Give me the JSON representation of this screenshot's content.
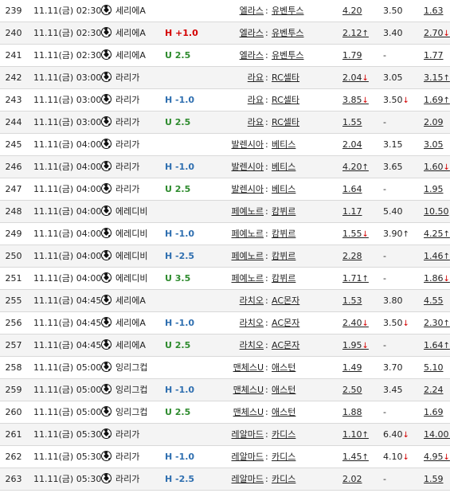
{
  "rows": [
    {
      "no": "239",
      "time": "11.11(금) 02:30",
      "league": "세리에A",
      "handicap": "",
      "home": "엘라스",
      "away": "유벤투스",
      "odds": [
        "4.20",
        "3.50",
        "1.63"
      ],
      "arrows": [
        "",
        "",
        ""
      ]
    },
    {
      "no": "240",
      "time": "11.11(금) 02:30",
      "league": "세리에A",
      "handicap": "H +1.0",
      "home": "엘라스",
      "away": "유벤투스",
      "odds": [
        "2.12",
        "3.40",
        "2.70"
      ],
      "arrows": [
        "↑",
        "",
        "↓"
      ]
    },
    {
      "no": "241",
      "time": "11.11(금) 02:30",
      "league": "세리에A",
      "handicap": "U 2.5",
      "home": "엘라스",
      "away": "유벤투스",
      "odds": [
        "1.79",
        "-",
        "1.77"
      ],
      "arrows": [
        "",
        "",
        ""
      ]
    },
    {
      "no": "242",
      "time": "11.11(금) 03:00",
      "league": "라리가",
      "handicap": "",
      "home": "라요",
      "away": "RC셀타",
      "odds": [
        "2.04",
        "3.05",
        "3.15"
      ],
      "arrows": [
        "↓",
        "",
        "↑"
      ]
    },
    {
      "no": "243",
      "time": "11.11(금) 03:00",
      "league": "라리가",
      "handicap": "H -1.0",
      "home": "라요",
      "away": "RC셀타",
      "odds": [
        "3.85",
        "3.50",
        "1.69"
      ],
      "arrows": [
        "↓",
        "↓",
        "↑"
      ]
    },
    {
      "no": "244",
      "time": "11.11(금) 03:00",
      "league": "라리가",
      "handicap": "U 2.5",
      "home": "라요",
      "away": "RC셀타",
      "odds": [
        "1.55",
        "-",
        "2.09"
      ],
      "arrows": [
        "",
        "",
        ""
      ]
    },
    {
      "no": "245",
      "time": "11.11(금) 04:00",
      "league": "라리가",
      "handicap": "",
      "home": "발렌시아",
      "away": "베티스",
      "odds": [
        "2.04",
        "3.15",
        "3.05"
      ],
      "arrows": [
        "",
        "",
        ""
      ]
    },
    {
      "no": "246",
      "time": "11.11(금) 04:00",
      "league": "라리가",
      "handicap": "H -1.0",
      "home": "발렌시아",
      "away": "베티스",
      "odds": [
        "4.20",
        "3.65",
        "1.60"
      ],
      "arrows": [
        "↑",
        "",
        "↓"
      ]
    },
    {
      "no": "247",
      "time": "11.11(금) 04:00",
      "league": "라리가",
      "handicap": "U 2.5",
      "home": "발렌시아",
      "away": "베티스",
      "odds": [
        "1.64",
        "-",
        "1.95"
      ],
      "arrows": [
        "",
        "",
        ""
      ]
    },
    {
      "no": "248",
      "time": "11.11(금) 04:00",
      "league": "에레디비",
      "handicap": "",
      "home": "페예노르",
      "away": "캄뷔르",
      "odds": [
        "1.17",
        "5.40",
        "10.50"
      ],
      "arrows": [
        "",
        "",
        ""
      ]
    },
    {
      "no": "249",
      "time": "11.11(금) 04:00",
      "league": "에레디비",
      "handicap": "H -1.0",
      "home": "페예노르",
      "away": "캄뷔르",
      "odds": [
        "1.55",
        "3.90",
        "4.25"
      ],
      "arrows": [
        "↓",
        "↑",
        "↑"
      ]
    },
    {
      "no": "250",
      "time": "11.11(금) 04:00",
      "league": "에레디비",
      "handicap": "H -2.5",
      "home": "페예노르",
      "away": "캄뷔르",
      "odds": [
        "2.28",
        "-",
        "1.46"
      ],
      "arrows": [
        "",
        "",
        "↑"
      ]
    },
    {
      "no": "251",
      "time": "11.11(금) 04:00",
      "league": "에레디비",
      "handicap": "U 3.5",
      "home": "페예노르",
      "away": "캄뷔르",
      "odds": [
        "1.71",
        "-",
        "1.86"
      ],
      "arrows": [
        "↑",
        "",
        "↓"
      ]
    },
    {
      "no": "255",
      "time": "11.11(금) 04:45",
      "league": "세리에A",
      "handicap": "",
      "home": "라치오",
      "away": "AC몬자",
      "odds": [
        "1.53",
        "3.80",
        "4.55"
      ],
      "arrows": [
        "",
        "",
        ""
      ]
    },
    {
      "no": "256",
      "time": "11.11(금) 04:45",
      "league": "세리에A",
      "handicap": "H -1.0",
      "home": "라치오",
      "away": "AC몬자",
      "odds": [
        "2.40",
        "3.50",
        "2.30"
      ],
      "arrows": [
        "↓",
        "↓",
        "↑"
      ]
    },
    {
      "no": "257",
      "time": "11.11(금) 04:45",
      "league": "세리에A",
      "handicap": "U 2.5",
      "home": "라치오",
      "away": "AC몬자",
      "odds": [
        "1.95",
        "-",
        "1.64"
      ],
      "arrows": [
        "↓",
        "",
        "↑"
      ]
    },
    {
      "no": "258",
      "time": "11.11(금) 05:00",
      "league": "잉리그컵",
      "handicap": "",
      "home": "맨체스U",
      "away": "애스턴",
      "odds": [
        "1.49",
        "3.70",
        "5.10"
      ],
      "arrows": [
        "",
        "",
        ""
      ]
    },
    {
      "no": "259",
      "time": "11.11(금) 05:00",
      "league": "잉리그컵",
      "handicap": "H -1.0",
      "home": "맨체스U",
      "away": "애스턴",
      "odds": [
        "2.50",
        "3.45",
        "2.24"
      ],
      "arrows": [
        "",
        "",
        ""
      ]
    },
    {
      "no": "260",
      "time": "11.11(금) 05:00",
      "league": "잉리그컵",
      "handicap": "U 2.5",
      "home": "맨체스U",
      "away": "애스턴",
      "odds": [
        "1.88",
        "-",
        "1.69"
      ],
      "arrows": [
        "",
        "",
        ""
      ]
    },
    {
      "no": "261",
      "time": "11.11(금) 05:30",
      "league": "라리가",
      "handicap": "",
      "home": "레알마드",
      "away": "카디스",
      "odds": [
        "1.10",
        "6.40",
        "14.00"
      ],
      "arrows": [
        "↑",
        "↓",
        "↓"
      ]
    },
    {
      "no": "262",
      "time": "11.11(금) 05:30",
      "league": "라리가",
      "handicap": "H -1.0",
      "home": "레알마드",
      "away": "카디스",
      "odds": [
        "1.45",
        "4.10",
        "4.95"
      ],
      "arrows": [
        "↑",
        "↓",
        "↓"
      ]
    },
    {
      "no": "263",
      "time": "11.11(금) 05:30",
      "league": "라리가",
      "handicap": "H -2.5",
      "home": "레알마드",
      "away": "카디스",
      "odds": [
        "2.02",
        "-",
        "1.59"
      ],
      "arrows": [
        "",
        "",
        ""
      ]
    }
  ],
  "colon": ":",
  "colors": {
    "handicap_h": "#2f6fb0",
    "handicap_h_plus": "#d40000",
    "handicap_u": "#2e8b2e",
    "arrow_down": "#d40000",
    "arrow_up": "#222222"
  }
}
